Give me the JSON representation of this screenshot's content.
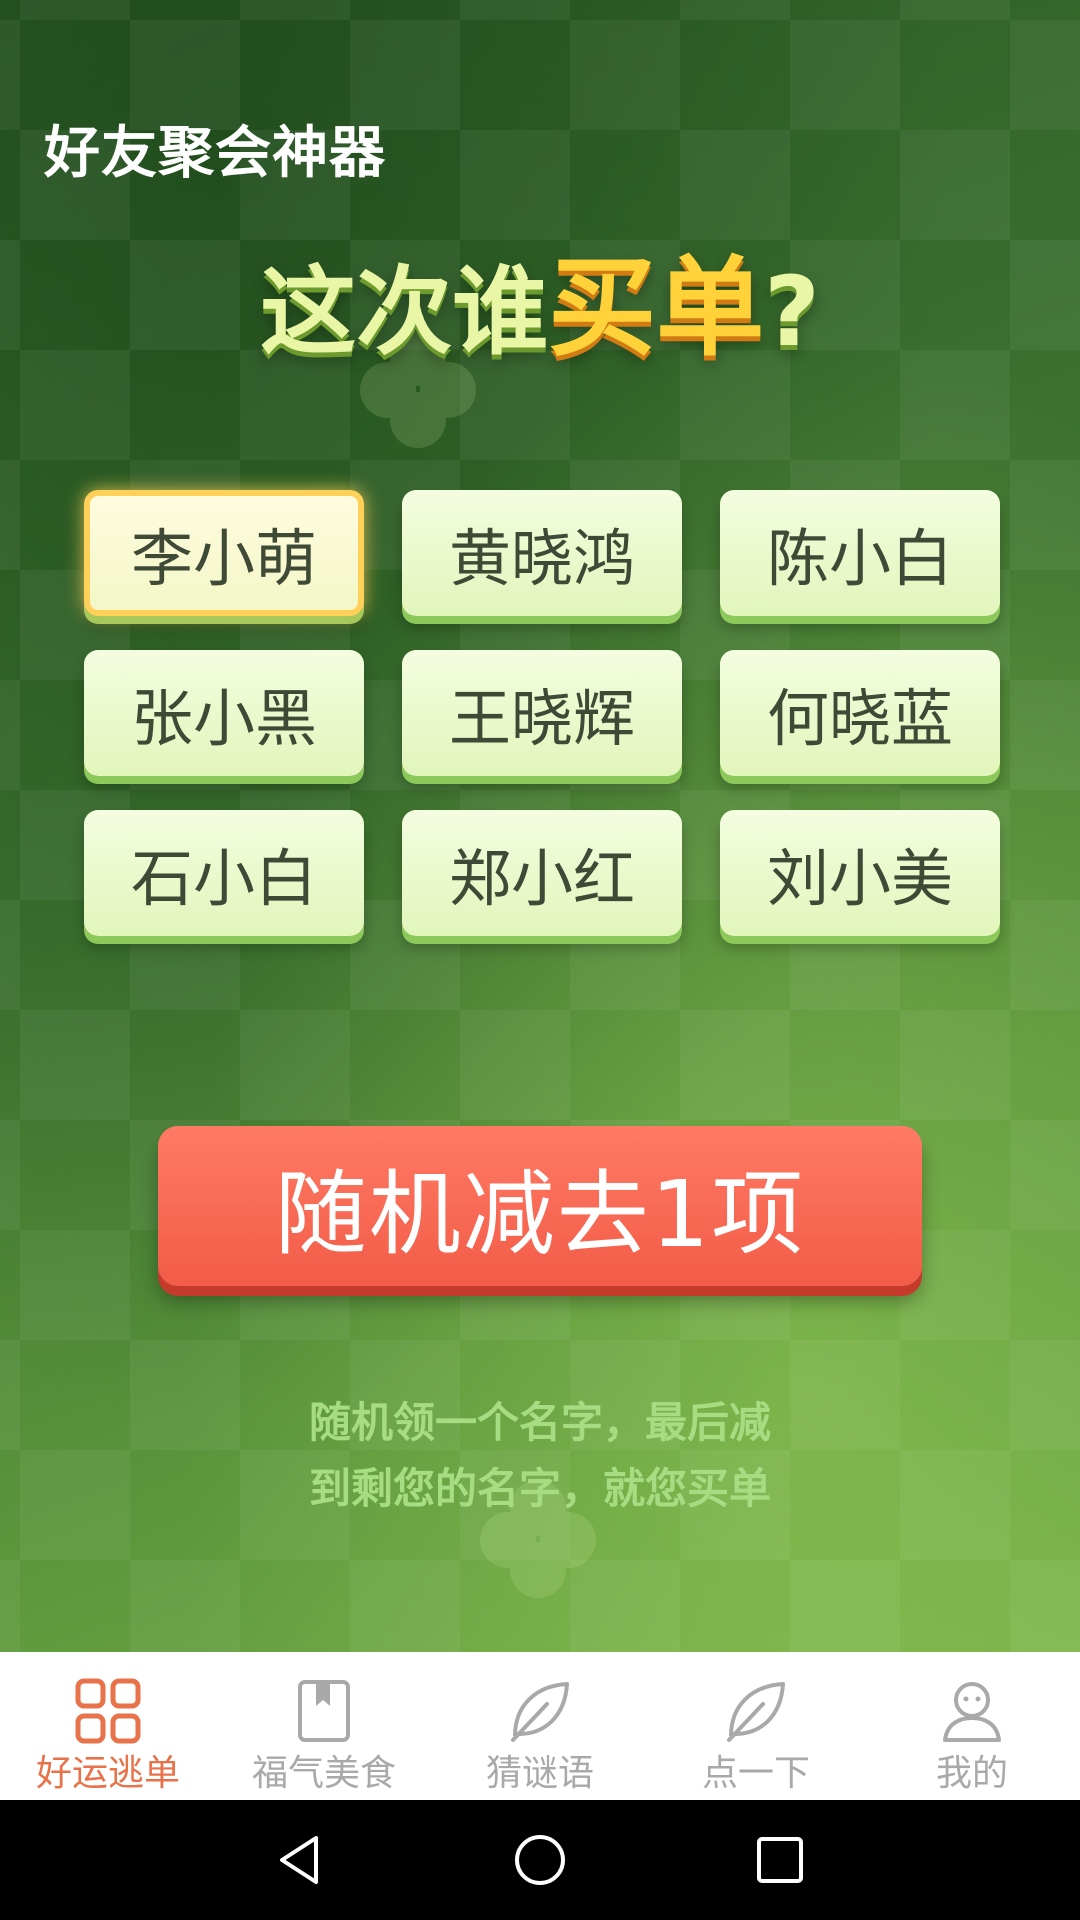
{
  "app_title": "好友聚会神器",
  "headline": {
    "part1": "这次谁",
    "part2": "买单",
    "part3": "?"
  },
  "names": [
    {
      "label": "李小萌",
      "selected": true
    },
    {
      "label": "黄晓鸿",
      "selected": false
    },
    {
      "label": "陈小白",
      "selected": false
    },
    {
      "label": "张小黑",
      "selected": false
    },
    {
      "label": "王晓辉",
      "selected": false
    },
    {
      "label": "何晓蓝",
      "selected": false
    },
    {
      "label": "石小白",
      "selected": false
    },
    {
      "label": "郑小红",
      "selected": false
    },
    {
      "label": "刘小美",
      "selected": false
    }
  ],
  "action_button": "随机减去1项",
  "hint": {
    "line1": "随机领一个名字，最后减",
    "line2": "到剩您的名字，就您买单"
  },
  "tabs": [
    {
      "label": "好运逃单",
      "icon": "grid-icon",
      "active": true
    },
    {
      "label": "福气美食",
      "icon": "book-icon",
      "active": false
    },
    {
      "label": "猜谜语",
      "icon": "leaf-icon",
      "active": false
    },
    {
      "label": "点一下",
      "icon": "leaf-icon",
      "active": false
    },
    {
      "label": "我的",
      "icon": "person-icon",
      "active": false
    }
  ],
  "system_nav": [
    "back-icon",
    "home-icon",
    "recents-icon"
  ],
  "colors": {
    "accent": "#e8734a",
    "button": "#f25c48",
    "headline_yellow": "#ffd23a",
    "tab_inactive": "#a9a9a9"
  }
}
